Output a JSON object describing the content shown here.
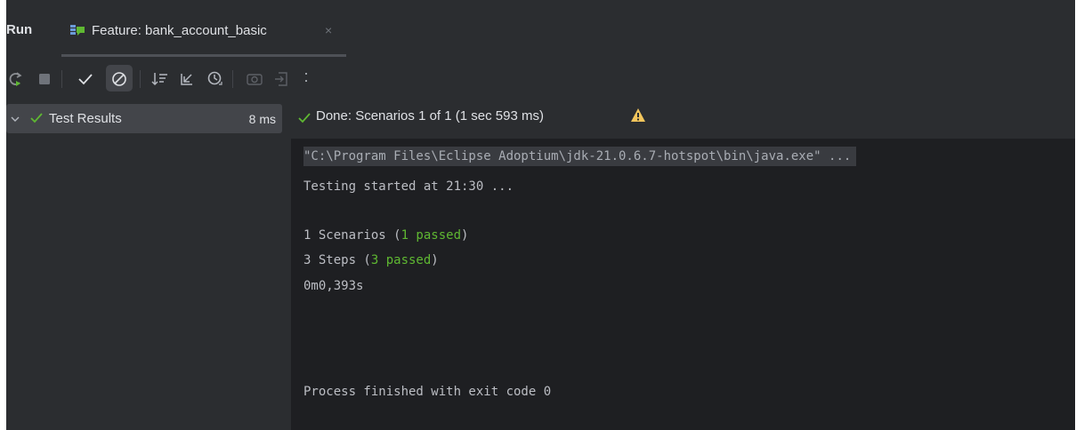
{
  "window": {
    "run_label": "Run",
    "tab_label": "Feature: bank_account_basic",
    "tab_close": "×"
  },
  "toolbar": {
    "buttons": [
      "rerun-icon",
      "stop-icon",
      "show-passed-icon",
      "show-ignored-icon",
      "sort-icon",
      "collapse-icon",
      "history-icon",
      "screenshot-icon",
      "export-icon",
      "more-icon"
    ],
    "more": ":"
  },
  "tree": {
    "root_label": "Test Results",
    "root_time": "8 ms"
  },
  "status": {
    "text": "Done: Scenarios 1 of 1  (1 sec 593 ms)"
  },
  "console": {
    "command": "\"C:\\Program Files\\Eclipse Adoptium\\jdk-21.0.6.7-hotspot\\bin\\java.exe\" ...",
    "started": "Testing started at 21:30 ...",
    "scenarios_prefix": "1 Scenarios (",
    "scenarios_passed": "1 passed",
    "scenarios_suffix": ")",
    "steps_prefix": "3 Steps (",
    "steps_passed": "3 passed",
    "steps_suffix": ")",
    "duration": "0m0,393s",
    "finished": "Process finished with exit code 0"
  },
  "colors": {
    "panel_bg": "#2b2d30",
    "console_bg": "#1e1f22",
    "passed_green": "#5fb832",
    "warning_yellow": "#f2c55c",
    "check_green": "#5fb832"
  }
}
